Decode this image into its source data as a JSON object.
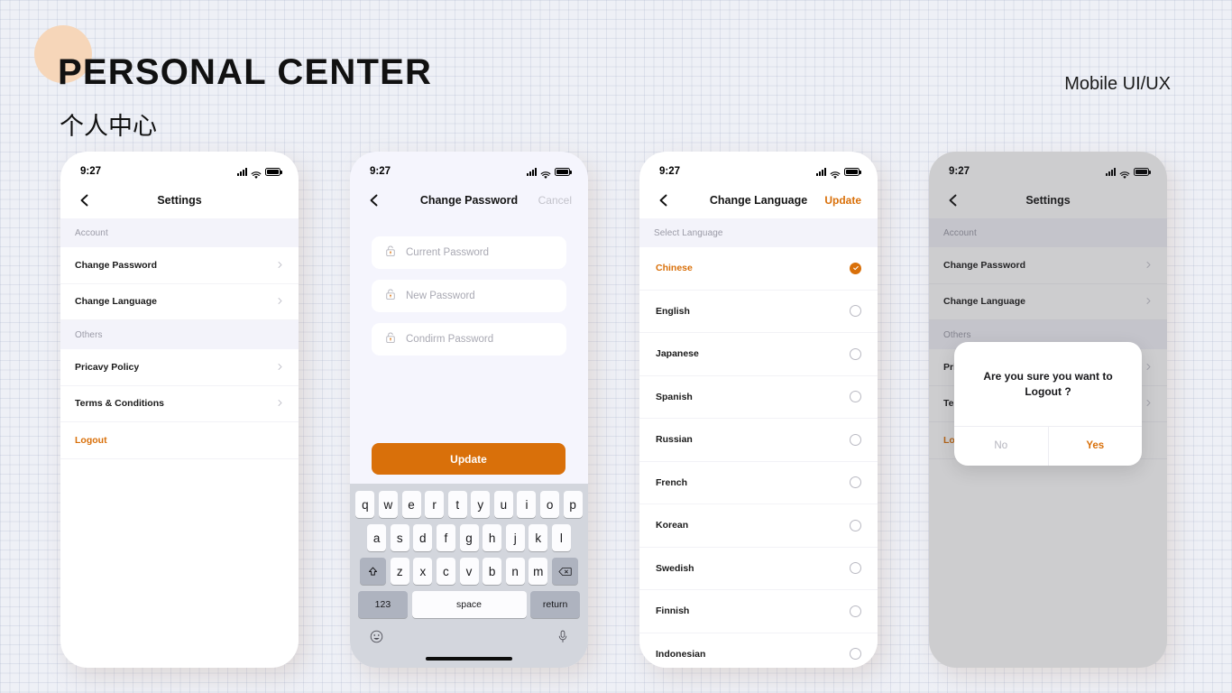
{
  "header": {
    "title": "PERSONAL CENTER",
    "subtitle": "个人中心",
    "right_label": "Mobile UI/UX"
  },
  "colors": {
    "accent": "#d9700a",
    "circle": "#f6d6b9",
    "background": "#eef0f6",
    "section_header": "#f3f3fa"
  },
  "status_bar": {
    "time": "9:27"
  },
  "icons": {
    "back": "chevron-left-icon",
    "chevron": "chevron-right-icon",
    "signal": "signal-bars-icon",
    "wifi": "wifi-icon",
    "battery": "battery-full-icon",
    "lock": "lock-open-icon",
    "check": "check-icon",
    "shift": "shift-key-icon",
    "backspace": "backspace-icon",
    "emoji": "emoji-icon",
    "mic": "microphone-icon"
  },
  "screens": {
    "settings": {
      "nav_title": "Settings",
      "sections": [
        {
          "header": "Account",
          "rows": [
            {
              "label": "Change Password",
              "accent": false
            },
            {
              "label": "Change Language",
              "accent": false
            }
          ]
        },
        {
          "header": "Others",
          "rows": [
            {
              "label": "Pricavy Policy",
              "accent": false
            },
            {
              "label": "Terms & Conditions",
              "accent": false
            },
            {
              "label": "Logout",
              "accent": true
            }
          ]
        }
      ]
    },
    "change_password": {
      "nav_title": "Change Password",
      "cancel_label": "Cancel",
      "fields": [
        {
          "placeholder": "Current Password",
          "value": ""
        },
        {
          "placeholder": "New Password",
          "value": ""
        },
        {
          "placeholder": "Condirm Password",
          "value": ""
        }
      ],
      "submit_label": "Update"
    },
    "change_language": {
      "nav_title": "Change Language",
      "update_label": "Update",
      "section_header": "Select Language",
      "selected": "Chinese",
      "languages": [
        {
          "label": "Chinese",
          "selected": true
        },
        {
          "label": "English",
          "selected": false
        },
        {
          "label": "Japanese",
          "selected": false
        },
        {
          "label": "Spanish",
          "selected": false
        },
        {
          "label": "Russian",
          "selected": false
        },
        {
          "label": "French",
          "selected": false
        },
        {
          "label": "Korean",
          "selected": false
        },
        {
          "label": "Swedish",
          "selected": false
        },
        {
          "label": "Finnish",
          "selected": false
        },
        {
          "label": "Indonesian",
          "selected": false
        }
      ]
    },
    "logout_dialog": {
      "nav_title": "Settings",
      "message": "Are you sure you want to Logout ?",
      "no_label": "No",
      "yes_label": "Yes"
    }
  },
  "keyboard": {
    "row1": [
      "q",
      "w",
      "e",
      "r",
      "t",
      "y",
      "u",
      "i",
      "o",
      "p"
    ],
    "row2": [
      "a",
      "s",
      "d",
      "f",
      "g",
      "h",
      "j",
      "k",
      "l"
    ],
    "row3": [
      "z",
      "x",
      "c",
      "v",
      "b",
      "n",
      "m"
    ],
    "numeric_label": "123",
    "space_label": "space",
    "return_label": "return"
  }
}
